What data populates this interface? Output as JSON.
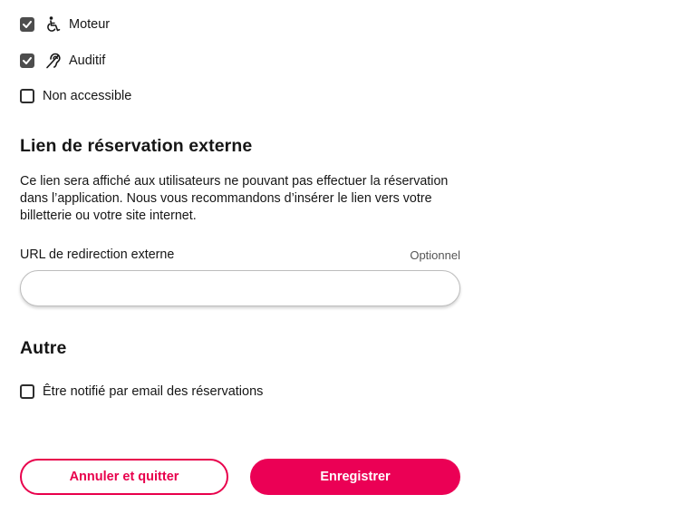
{
  "accessibility": {
    "items": [
      {
        "label": "Moteur",
        "checked": true,
        "icon": "wheelchair-icon"
      },
      {
        "label": "Auditif",
        "checked": true,
        "icon": "hearing-impaired-icon"
      },
      {
        "label": "Non accessible",
        "checked": false,
        "icon": null
      }
    ]
  },
  "external_booking": {
    "heading": "Lien de réservation externe",
    "description": "Ce lien sera affiché aux utilisateurs ne pouvant pas effectuer la réservation dans l’application. Nous vous recommandons d’insérer le lien vers votre billetterie ou votre site internet.",
    "url_field": {
      "label": "URL de redirection externe",
      "optional_label": "Optionnel",
      "value": "",
      "placeholder": ""
    }
  },
  "other": {
    "heading": "Autre",
    "notify_label": "Être notifié par email des réservations",
    "notify_checked": false
  },
  "actions": {
    "cancel_label": "Annuler et quitter",
    "save_label": "Enregistrer"
  },
  "colors": {
    "accent": "#eb0055",
    "checkbox_checked": "#4d4d4d",
    "text": "#161616"
  }
}
